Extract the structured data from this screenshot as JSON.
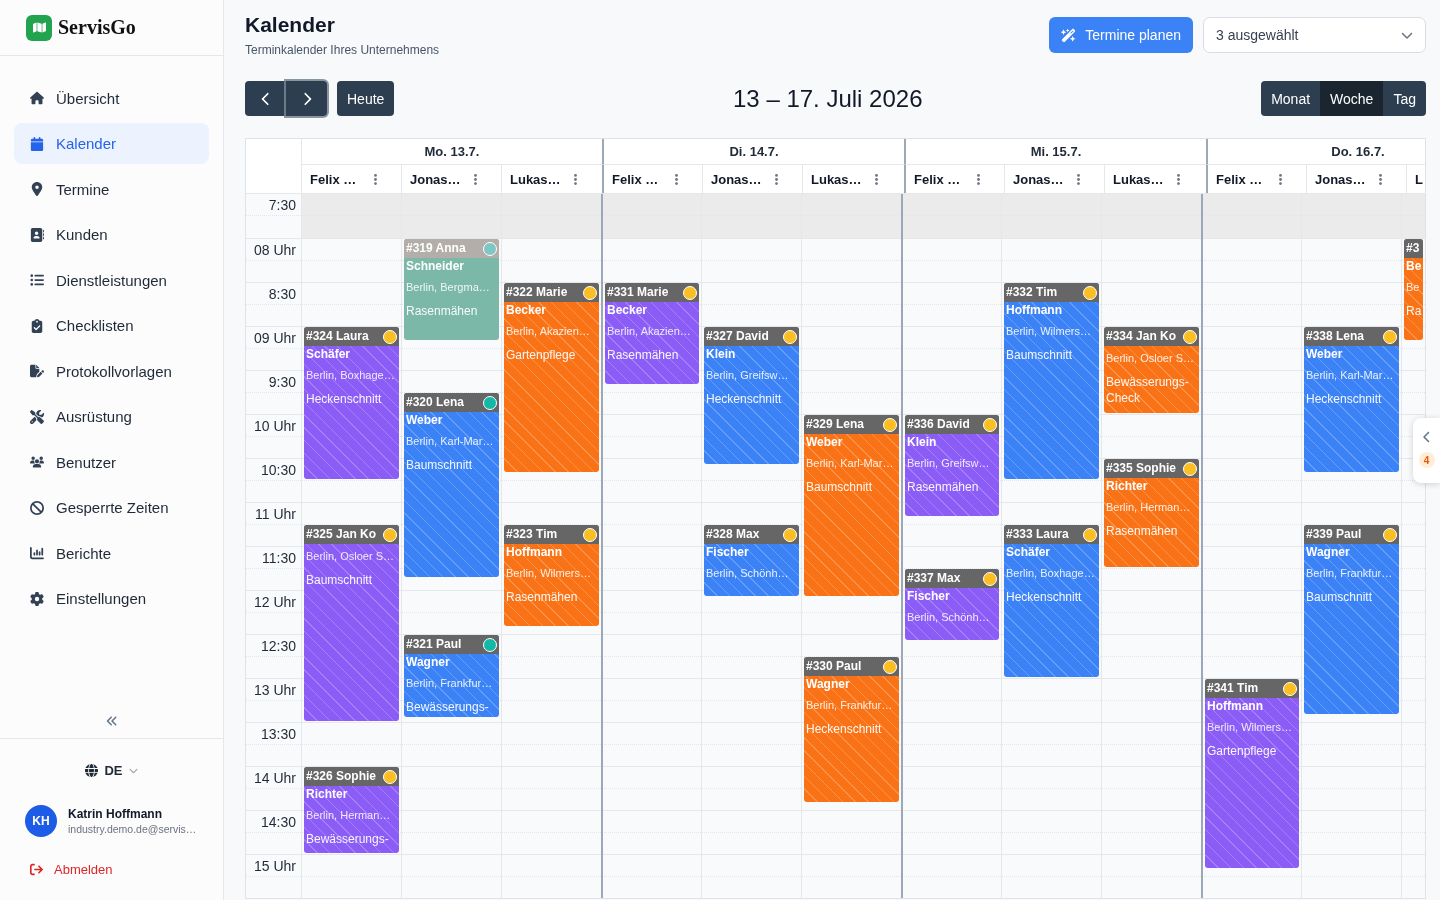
{
  "sidebar": {
    "brand": "ServisGo",
    "nav": [
      {
        "label": "Übersicht",
        "selected": false
      },
      {
        "label": "Kalender",
        "selected": true
      },
      {
        "label": "Termine",
        "selected": false
      },
      {
        "label": "Kunden",
        "selected": false
      },
      {
        "label": "Dienstleistungen",
        "selected": false
      },
      {
        "label": "Checklisten",
        "selected": false
      },
      {
        "label": "Protokollvorlagen",
        "selected": false
      },
      {
        "label": "Ausrüstung",
        "selected": false
      },
      {
        "label": "Benutzer",
        "selected": false
      },
      {
        "label": "Gesperrte Zeiten",
        "selected": false
      },
      {
        "label": "Berichte",
        "selected": false
      },
      {
        "label": "Einstellungen",
        "selected": false
      }
    ],
    "language": "DE",
    "user": {
      "initials": "KH",
      "name": "Katrin Hoffmann",
      "email": "industry.demo.de@servis…"
    },
    "logout": "Abmelden"
  },
  "header": {
    "title": "Kalender",
    "subtitle": "Terminkalender Ihres Unternehmens",
    "plan_button": "Termine planen",
    "filter": {
      "value": "3 ausgewählt"
    }
  },
  "toolbar": {
    "nav": [
      {
        "kind": "prev",
        "focused": false
      },
      {
        "kind": "next",
        "focused": true
      }
    ],
    "today": "Heute",
    "title": "13 – 17. Juli 2026",
    "views": [
      {
        "label": "Monat",
        "selected": false
      },
      {
        "label": "Woche",
        "selected": true
      },
      {
        "label": "Tag",
        "selected": false
      }
    ]
  },
  "calendar": {
    "times": [
      {
        "label": "7:30",
        "closed": true
      },
      {
        "label": "08 Uhr",
        "closed": false
      },
      {
        "label": "8:30",
        "closed": false
      },
      {
        "label": "09 Uhr",
        "closed": false
      },
      {
        "label": "9:30",
        "closed": false
      },
      {
        "label": "10 Uhr",
        "closed": false
      },
      {
        "label": "10:30",
        "closed": false
      },
      {
        "label": "11 Uhr",
        "closed": false
      },
      {
        "label": "11:30",
        "closed": false
      },
      {
        "label": "12 Uhr",
        "closed": false
      },
      {
        "label": "12:30",
        "closed": false
      },
      {
        "label": "13 Uhr",
        "closed": false
      },
      {
        "label": "13:30",
        "closed": false
      },
      {
        "label": "14 Uhr",
        "closed": false
      },
      {
        "label": "14:30",
        "closed": false
      },
      {
        "label": "15 Uhr",
        "closed": false
      }
    ],
    "days": [
      {
        "label": "Mo. 13.7.",
        "resources": [
          {
            "name": "Felix …",
            "menu": true,
            "events": [
              {
                "title": "#324 Laura",
                "name": "Schäfer",
                "address": "Berlin, Boxhage…",
                "service": "Heckenschnitt",
                "color": "#8b5cf6",
                "done": false,
                "status": {
                  "color": "#fbbf24"
                }
              },
              {
                "title": "#325 Jan Ko",
                "address": "Berlin, Osloer S…",
                "service": "Baumschnitt",
                "color": "#8b5cf6",
                "done": false,
                "status": {
                  "color": "#fbbf24"
                }
              },
              {
                "title": "#326 Sophie",
                "name": "Richter",
                "address": "Berlin, Herman…",
                "service": "Bewässerungs-",
                "color": "#8b5cf6",
                "done": false,
                "status": {
                  "color": "#fbbf24"
                }
              }
            ]
          },
          {
            "name": "Jonas…",
            "menu": true,
            "events": [
              {
                "title": "#319 Anna",
                "name": "Schneider",
                "address": "Berlin, Bergma…",
                "service": "Rasenmähen",
                "color": "#7bb8a8",
                "done": true,
                "status": {
                  "color": "#80c6c4"
                }
              },
              {
                "title": "#320 Lena",
                "name": "Weber",
                "address": "Berlin, Karl-Mar…",
                "service": "Baumschnitt",
                "color": "#3b82f6",
                "done": false,
                "status": {
                  "color": "#14b8a6"
                }
              },
              {
                "title": "#321 Paul",
                "name": "Wagner",
                "address": "Berlin, Frankfur…",
                "service": "Bewässerungs-",
                "color": "#3b82f6",
                "done": false,
                "status": {
                  "color": "#14b8a6"
                }
              }
            ]
          },
          {
            "name": "Lukas…",
            "menu": true,
            "events": [
              {
                "title": "#322 Marie",
                "name": "Becker",
                "address": "Berlin, Akazien…",
                "service": "Gartenpflege",
                "color": "#f97316",
                "done": false,
                "status": {
                  "color": "#fbbf24"
                }
              },
              {
                "title": "#323 Tim",
                "name": "Hoffmann",
                "address": "Berlin, Wilmers…",
                "service": "Rasenmähen",
                "color": "#f97316",
                "done": false,
                "status": {
                  "color": "#fbbf24"
                }
              }
            ]
          }
        ]
      },
      {
        "label": "Di. 14.7.",
        "resources": [
          {
            "name": "Felix …",
            "menu": true,
            "events": [
              {
                "title": "#331 Marie",
                "name": "Becker",
                "address": "Berlin, Akazien…",
                "service": "Rasenmähen",
                "color": "#8b5cf6",
                "done": false,
                "status": {
                  "color": "#fbbf24"
                }
              }
            ]
          },
          {
            "name": "Jonas…",
            "menu": true,
            "events": [
              {
                "title": "#327 David",
                "name": "Klein",
                "address": "Berlin, Greifsw…",
                "service": "Heckenschnitt",
                "color": "#3b82f6",
                "done": false,
                "status": {
                  "color": "#fbbf24"
                }
              },
              {
                "title": "#328 Max",
                "name": "Fischer",
                "address": "Berlin, Schönh…",
                "color": "#3b82f6",
                "done": false,
                "status": {
                  "color": "#fbbf24"
                }
              }
            ]
          },
          {
            "name": "Lukas…",
            "menu": true,
            "events": [
              {
                "title": "#329 Lena",
                "name": "Weber",
                "address": "Berlin, Karl-Mar…",
                "service": "Baumschnitt",
                "color": "#f97316",
                "done": false,
                "status": {
                  "color": "#fbbf24"
                }
              },
              {
                "title": "#330 Paul",
                "name": "Wagner",
                "address": "Berlin, Frankfur…",
                "service": "Heckenschnitt",
                "color": "#f97316",
                "done": false,
                "status": {
                  "color": "#fbbf24"
                }
              }
            ]
          }
        ]
      },
      {
        "label": "Mi. 15.7.",
        "resources": [
          {
            "name": "Felix …",
            "menu": true,
            "events": [
              {
                "title": "#336 David",
                "name": "Klein",
                "address": "Berlin, Greifsw…",
                "service": "Rasenmähen",
                "color": "#8b5cf6",
                "done": false,
                "status": {
                  "color": "#fbbf24"
                }
              },
              {
                "title": "#337 Max",
                "name": "Fischer",
                "address": "Berlin, Schönh…",
                "color": "#8b5cf6",
                "done": false,
                "status": {
                  "color": "#fbbf24"
                }
              }
            ]
          },
          {
            "name": "Jonas…",
            "menu": true,
            "events": [
              {
                "title": "#332 Tim",
                "name": "Hoffmann",
                "address": "Berlin, Wilmers…",
                "service": "Baumschnitt",
                "color": "#3b82f6",
                "done": false,
                "status": {
                  "color": "#fbbf24"
                }
              },
              {
                "title": "#333 Laura",
                "name": "Schäfer",
                "address": "Berlin, Boxhage…",
                "service": "Heckenschnitt",
                "color": "#3b82f6",
                "done": false,
                "status": {
                  "color": "#fbbf24"
                }
              }
            ]
          },
          {
            "name": "Lukas…",
            "menu": true,
            "events": [
              {
                "title": "#334 Jan Ko",
                "address": "Berlin, Osloer S…",
                "service": "Bewässerungs-Check",
                "color": "#f97316",
                "done": false,
                "status": {
                  "color": "#fbbf24"
                }
              },
              {
                "title": "#335 Sophie",
                "name": "Richter",
                "address": "Berlin, Herman…",
                "service": "Rasenmähen",
                "color": "#f97316",
                "done": false,
                "status": {
                  "color": "#fbbf24"
                }
              }
            ]
          }
        ]
      },
      {
        "label": "Do. 16.7.",
        "resources": [
          {
            "name": "Felix …",
            "menu": true,
            "events": [
              {
                "title": "#341 Tim",
                "name": "Hoffmann",
                "address": "Berlin, Wilmers…",
                "service": "Gartenpflege",
                "color": "#8b5cf6",
                "done": false,
                "status": {
                  "color": "#fbbf24"
                }
              }
            ]
          },
          {
            "name": "Jonas…",
            "menu": true,
            "events": [
              {
                "title": "#338 Lena",
                "name": "Weber",
                "address": "Berlin, Karl-Mar…",
                "service": "Heckenschnitt",
                "color": "#3b82f6",
                "done": false,
                "status": {
                  "color": "#fbbf24"
                }
              },
              {
                "title": "#339 Paul",
                "name": "Wagner",
                "address": "Berlin, Frankfur…",
                "service": "Baumschnitt",
                "color": "#3b82f6",
                "done": false,
                "status": {
                  "color": "#fbbf24"
                }
              }
            ]
          },
          {
            "name": "L",
            "menu": false,
            "events": [
              {
                "title": "#3",
                "name": "Be",
                "address": "Be",
                "service": "Ra",
                "color": "#f97316",
                "done": false
              }
            ]
          }
        ]
      }
    ]
  },
  "side_panel": {
    "badge": "4"
  }
}
